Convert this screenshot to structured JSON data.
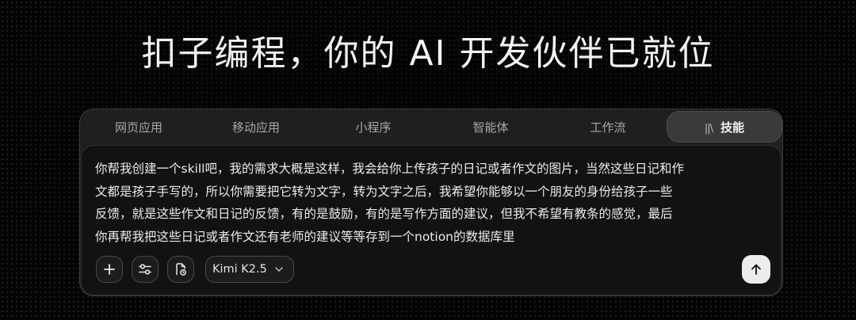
{
  "headline": "扣子编程，你的 AI 开发伙伴已就位",
  "tabs": [
    {
      "label": "网页应用"
    },
    {
      "label": "移动应用"
    },
    {
      "label": "小程序"
    },
    {
      "label": "智能体"
    },
    {
      "label": "工作流"
    },
    {
      "label": "技能",
      "icon": "library-icon",
      "active": true
    }
  ],
  "tab_skill_glyph": "||\\",
  "prompt": {
    "lines": [
      "你帮我创建一个skill吧，我的需求大概是这样，我会给你上传孩子的日记或者作文的图片，当然这些日记和作",
      "文都是孩子手写的，所以你需要把它转为文字，转为文字之后，我希望你能够以一个朋友的身份给孩子一些",
      "反馈，就是这些作文和日记的反馈，有的是鼓励，有的是写作方面的建议，但我不希望有教条的感觉，最后",
      "你再帮我把这些日记或者作文还有老师的建议等等存到一个notion的数据库里"
    ]
  },
  "toolbar": {
    "add_icon": "plus-icon",
    "settings_icon": "sliders-icon",
    "attach_icon": "file-sync-icon",
    "model_label": "Kimi K2.5",
    "model_icon": "chevron-down-icon",
    "send_icon": "arrow-up-icon"
  },
  "colors": {
    "background": "#050505",
    "panel": "#1f1f1f",
    "input": "#121212",
    "active_tab": "#3a3a3a",
    "send_button": "#ececec"
  }
}
